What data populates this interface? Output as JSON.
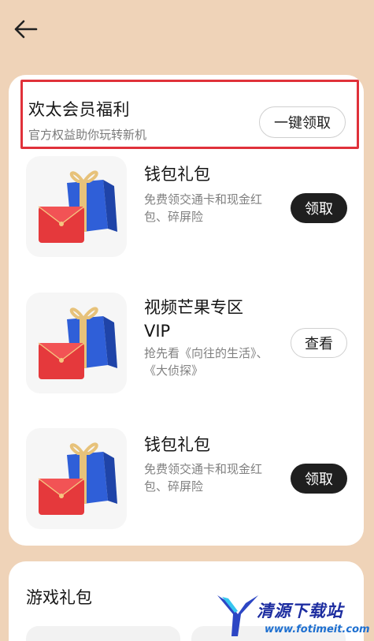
{
  "nav": {
    "back_icon": "arrow-left-icon"
  },
  "benefits": {
    "title": "欢太会员福利",
    "subtitle": "官方权益助你玩转新机",
    "claim_all_label": "一键领取",
    "items": [
      {
        "title": "钱包礼包",
        "desc": "免费领交通卡和现金红包、碎屏险",
        "action": "领取",
        "icon": "gift-box-icon"
      },
      {
        "title": "视频芒果专区VIP",
        "desc": "抢先看《向往的生活》、《大侦探》",
        "action": "查看",
        "icon": "gift-box-icon"
      },
      {
        "title": "钱包礼包",
        "desc": "免费领交通卡和现金红包、碎屏险",
        "action": "领取",
        "icon": "gift-box-icon"
      }
    ]
  },
  "games": {
    "title": "游戏礼包"
  },
  "watermark": {
    "name": "清源下载站",
    "url": "www.fotimeit.com"
  },
  "colors": {
    "background": "#efd3b8",
    "highlight": "#e0313a",
    "button_dark": "#1f1f1f"
  }
}
